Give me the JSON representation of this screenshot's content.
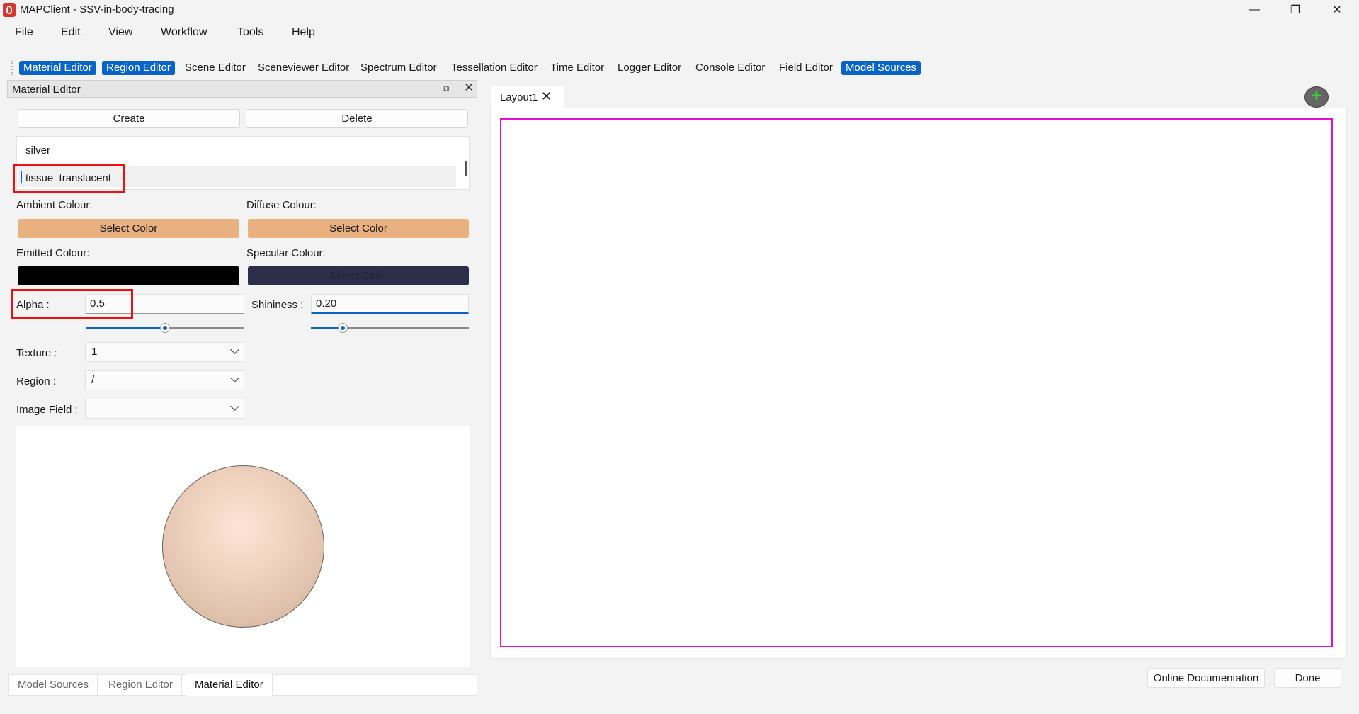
{
  "window": {
    "title": "MAPClient - SSV-in-body-tracing",
    "minimize": "—",
    "maximize": "❐",
    "close": "✕"
  },
  "menu": [
    "File",
    "Edit",
    "View",
    "Workflow",
    "Tools",
    "Help"
  ],
  "toolbar": [
    {
      "label": "Material Editor",
      "active": true
    },
    {
      "label": "Region Editor",
      "active": true
    },
    {
      "label": "Scene Editor",
      "active": false
    },
    {
      "label": "Sceneviewer Editor",
      "active": false
    },
    {
      "label": "Spectrum Editor",
      "active": false
    },
    {
      "label": "Tessellation Editor",
      "active": false
    },
    {
      "label": "Time Editor",
      "active": false
    },
    {
      "label": "Logger Editor",
      "active": false
    },
    {
      "label": "Console Editor",
      "active": false
    },
    {
      "label": "Field Editor",
      "active": false
    },
    {
      "label": "Model Sources",
      "active": true
    }
  ],
  "dock": {
    "title": "Material Editor",
    "float_icon": "⧉",
    "close_icon": "✕",
    "create_label": "Create",
    "delete_label": "Delete",
    "materials": [
      "silver",
      "tissue_translucent"
    ],
    "selected_material": "tissue_translucent",
    "ambient_label": "Ambient Colour:",
    "diffuse_label": "Diffuse Colour:",
    "emitted_label": "Emitted Colour:",
    "specular_label": "Specular Colour:",
    "select_color_label": "Select Color",
    "colors": {
      "ambient": "#e8b17f",
      "diffuse": "#e8b17f",
      "emitted": "#000000",
      "specular": "#2f2e4a",
      "selection_box": "#ee1111",
      "accent": "#0a64c8"
    },
    "alpha_label": "Alpha :",
    "alpha_value": "0.5",
    "alpha_slider": 0.5,
    "shininess_label": "Shininess :",
    "shininess_value": "0.20",
    "shininess_slider": 0.2,
    "texture_label": "Texture :",
    "texture_value": "1",
    "region_label": "Region :",
    "region_value": "/",
    "image_field_label": "Image Field :",
    "image_field_value": ""
  },
  "bottom_tabs": [
    {
      "label": "Model Sources",
      "active": false
    },
    {
      "label": "Region Editor",
      "active": false
    },
    {
      "label": "Material Editor",
      "active": true
    }
  ],
  "layout": {
    "tab_label": "Layout1",
    "close_icon": "✕",
    "add_icon": "+",
    "viewport_border": "#e010d8"
  },
  "footer": {
    "online_docs": "Online Documentation",
    "done": "Done"
  }
}
